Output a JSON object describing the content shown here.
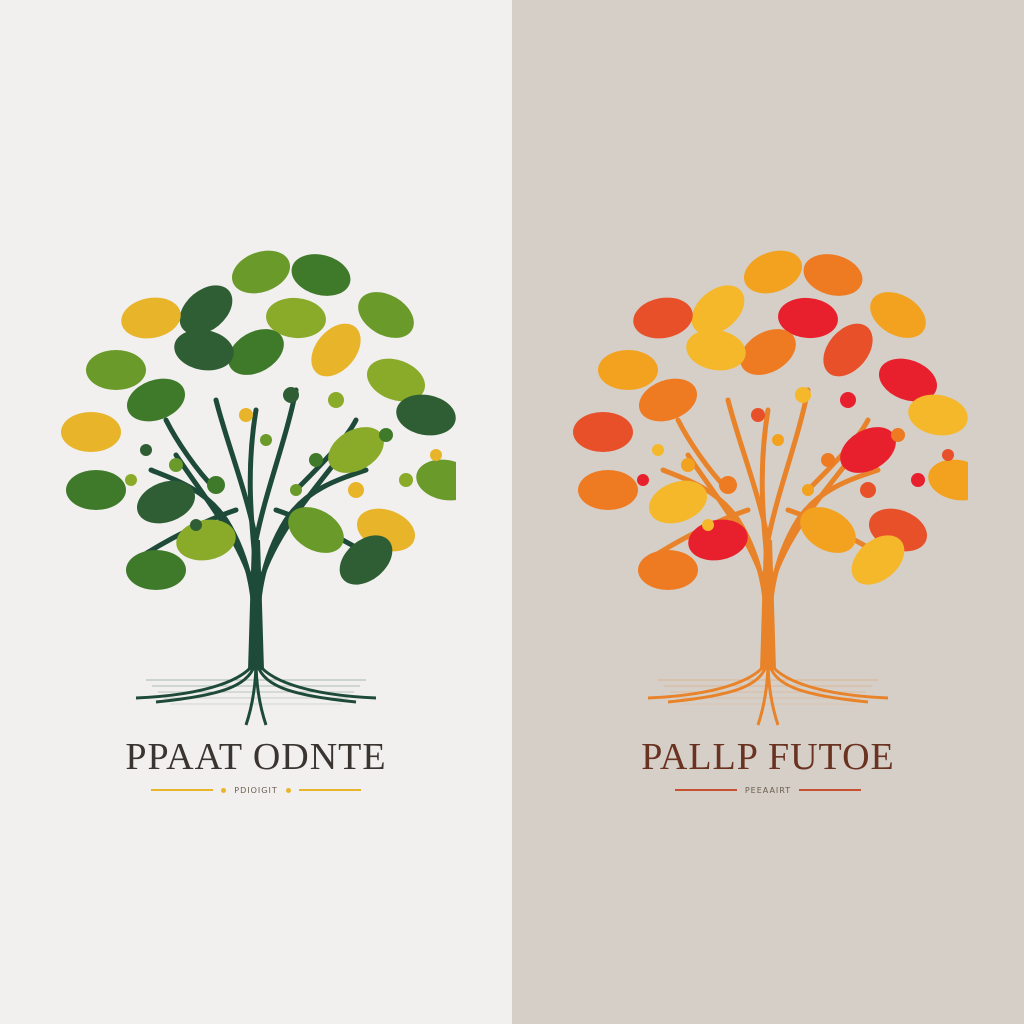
{
  "logos": [
    {
      "brand_name": "PPAAT ODNTE",
      "tagline": "PDIOIGIT",
      "palette": {
        "background": "#f1f0ee",
        "trunk": "#1e4a3a",
        "leaves": [
          "#6a9a2a",
          "#3f7a2a",
          "#2f5e34",
          "#e8b42a",
          "#8aaa2a"
        ],
        "rule": "#e8b42a",
        "text": "#3a3530"
      }
    },
    {
      "brand_name": "PALLP FUTOE",
      "tagline": "PEEAAIRT",
      "palette": {
        "background": "#d6cfc8",
        "trunk": "#e8832a",
        "leaves": [
          "#f2a21e",
          "#ee7a22",
          "#f4b82a",
          "#e8502a",
          "#e8202e"
        ],
        "rule": "#c8502e",
        "text": "#6a3220"
      }
    }
  ]
}
